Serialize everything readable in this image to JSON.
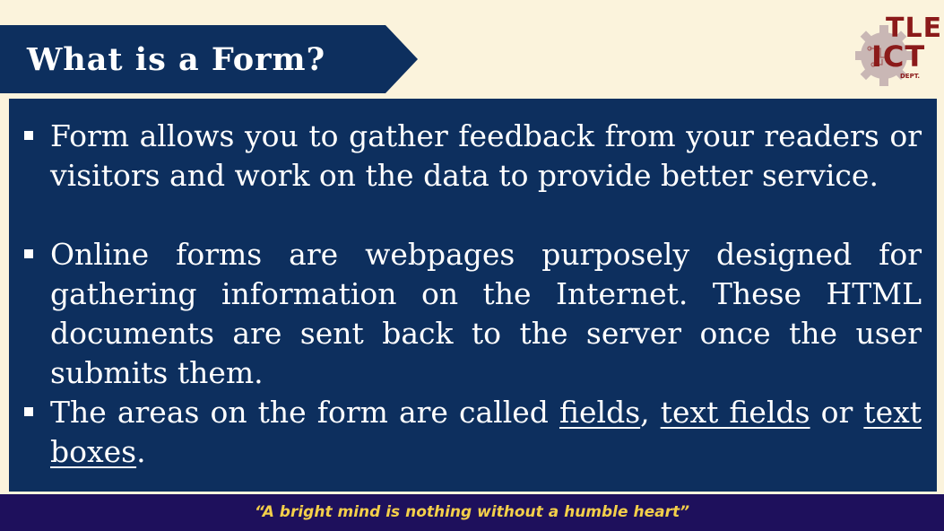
{
  "slide": {
    "title": "What is a Form?",
    "logo": {
      "line1": "TLE",
      "line2": "ICT",
      "sub": "DEPT."
    },
    "bullets": [
      {
        "segments": [
          {
            "text": "Form allows you to gather feedback from your readers or visitors and work on the data to provide better service.",
            "underline": false
          }
        ]
      },
      {
        "segments": [
          {
            "text": "Online forms are webpages purposely designed for gathering information on the Internet.  These HTML documents are sent back to the server once the user submits them.",
            "underline": false
          }
        ]
      },
      {
        "segments": [
          {
            "text": "The areas on the form are called ",
            "underline": false
          },
          {
            "text": "fields",
            "underline": true
          },
          {
            "text": ", ",
            "underline": false
          },
          {
            "text": "text fields",
            "underline": true
          },
          {
            "text": " or ",
            "underline": false
          },
          {
            "text": "text boxes",
            "underline": true
          },
          {
            "text": ".",
            "underline": false
          }
        ]
      }
    ],
    "footer_quote": "“A bright mind is nothing without a humble heart”"
  },
  "colors": {
    "background": "#fbf3dc",
    "panel": "#0d2f5e",
    "banner": "#0d2f5e",
    "footer": "#1e105c",
    "footer_text": "#f3cf4a",
    "logo": "#8b1a1a"
  }
}
